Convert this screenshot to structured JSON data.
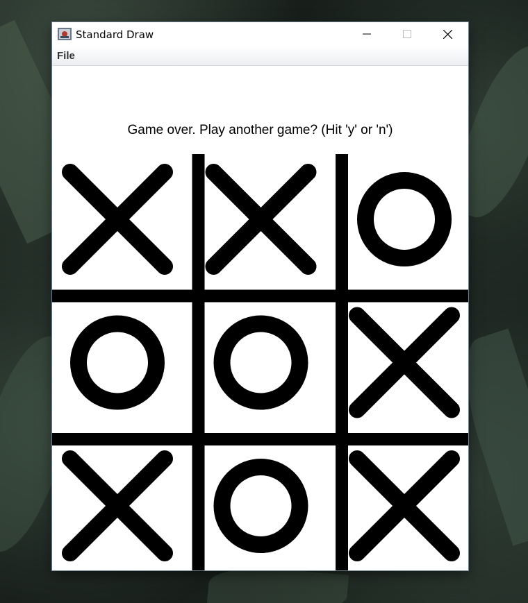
{
  "window": {
    "title": "Standard Draw",
    "controls": [
      "minimize",
      "maximize",
      "close"
    ]
  },
  "menu": {
    "items": [
      "File"
    ]
  },
  "game": {
    "message": "Game over.  Play another game?  (Hit 'y' or 'n')",
    "board": [
      [
        "X",
        "X",
        "O"
      ],
      [
        "O",
        "O",
        "X"
      ],
      [
        "X",
        "O",
        "X"
      ]
    ],
    "line_color": "#000000",
    "background_color": "#ffffff"
  }
}
